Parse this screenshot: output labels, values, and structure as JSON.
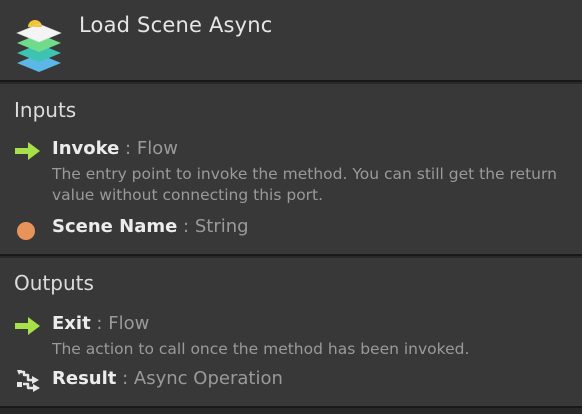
{
  "header": {
    "title": "Load Scene Async",
    "icon": "layers-stack-icon"
  },
  "inputs": {
    "title": "Inputs",
    "ports": [
      {
        "name": "Invoke",
        "separator": ":",
        "type": "Flow",
        "icon": "flow-arrow-icon",
        "description": "The entry point to invoke the method. You can still get the return value without connecting this port."
      },
      {
        "name": "Scene Name",
        "separator": ":",
        "type": "String",
        "icon": "string-dot-icon",
        "description": ""
      }
    ]
  },
  "outputs": {
    "title": "Outputs",
    "ports": [
      {
        "name": "Exit",
        "separator": ":",
        "type": "Flow",
        "icon": "flow-arrow-icon",
        "description": "The action to call once the method has been invoked."
      },
      {
        "name": "Result",
        "separator": ":",
        "type": "Async Operation",
        "icon": "async-operation-icon",
        "description": ""
      }
    ]
  },
  "colors": {
    "background": "#383838",
    "border": "#191919",
    "flow_arrow": "#a8e04a",
    "string_dot": "#e8935a",
    "muted_text": "#9a9a9a"
  }
}
